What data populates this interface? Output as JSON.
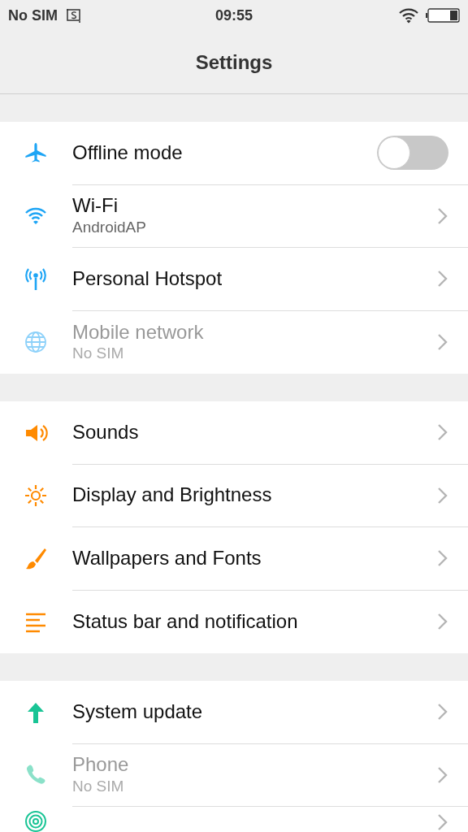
{
  "status_bar": {
    "carrier": "No SIM",
    "time": "09:55"
  },
  "title": "Settings",
  "sections": [
    {
      "items": [
        {
          "label": "Offline mode",
          "kind": "toggle",
          "on": false,
          "disabled": false
        },
        {
          "label": "Wi-Fi",
          "subtitle": "AndroidAP",
          "kind": "link",
          "disabled": false
        },
        {
          "label": "Personal Hotspot",
          "kind": "link",
          "disabled": false
        },
        {
          "label": "Mobile network",
          "subtitle": "No SIM",
          "kind": "link",
          "disabled": true
        }
      ]
    },
    {
      "items": [
        {
          "label": "Sounds",
          "kind": "link",
          "disabled": false
        },
        {
          "label": "Display and Brightness",
          "kind": "link",
          "disabled": false
        },
        {
          "label": "Wallpapers and Fonts",
          "kind": "link",
          "disabled": false
        },
        {
          "label": "Status bar and notification",
          "kind": "link",
          "disabled": false
        }
      ]
    },
    {
      "items": [
        {
          "label": "System update",
          "kind": "link",
          "disabled": false
        },
        {
          "label": "Phone",
          "subtitle": "No SIM",
          "kind": "link",
          "disabled": true
        },
        {
          "kind": "link",
          "disabled": false
        }
      ]
    }
  ]
}
